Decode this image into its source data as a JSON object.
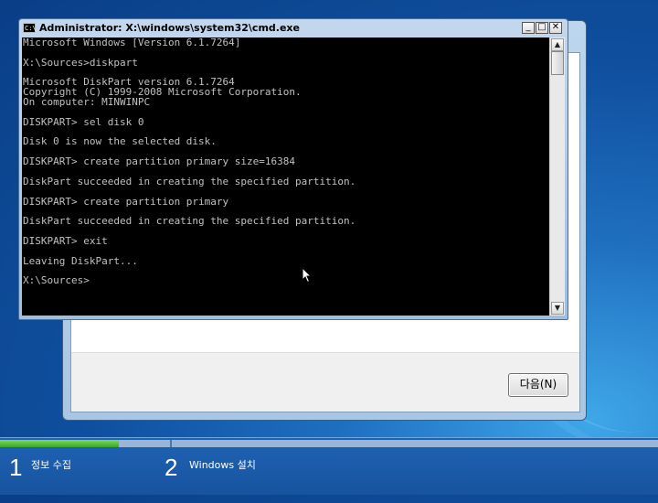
{
  "cmd": {
    "title": "Administrator: X:\\windows\\system32\\cmd.exe",
    "icon_glyph": "C:\\",
    "console_text": "Microsoft Windows [Version 6.1.7264]\n\nX:\\Sources>diskpart\n\nMicrosoft DiskPart version 6.1.7264\nCopyright (C) 1999-2008 Microsoft Corporation.\nOn computer: MINWINPC\n\nDISKPART> sel disk 0\n\nDisk 0 is now the selected disk.\n\nDISKPART> create partition primary size=16384\n\nDiskPart succeeded in creating the specified partition.\n\nDISKPART> create partition primary\n\nDiskPart succeeded in creating the specified partition.\n\nDISKPART> exit\n\nLeaving DiskPart...\n\nX:\\Sources>",
    "minimize_glyph": "_",
    "maximize_glyph": "□",
    "close_glyph": "✕",
    "scroll_up_glyph": "▲",
    "scroll_down_glyph": "▼"
  },
  "setup": {
    "next_button": "다음(N)"
  },
  "progress": {
    "fraction": 0.18
  },
  "steps": [
    {
      "number": "1",
      "label": "정보 수집"
    },
    {
      "number": "2",
      "label": "Windows 설치"
    }
  ],
  "icons": [
    "cmd-app-icon",
    "minimize-icon",
    "maximize-icon",
    "close-icon",
    "scroll-up-icon",
    "scroll-down-icon",
    "mouse-cursor-icon"
  ],
  "colors": {
    "console_bg": "#000000",
    "console_fg": "#c0c0c0",
    "progress_fill": "#4bbf35",
    "desktop": "#1f6fbf"
  }
}
